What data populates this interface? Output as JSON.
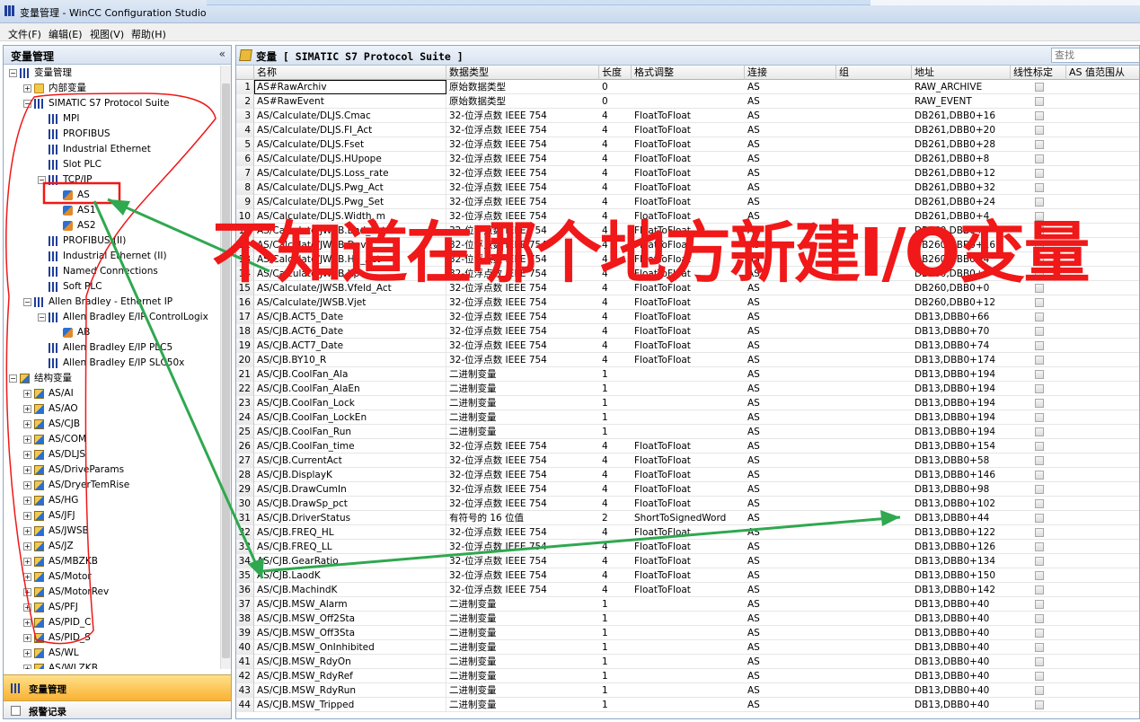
{
  "window": {
    "title": "变量管理 - WinCC Configuration Studio"
  },
  "menu": [
    "文件(F)",
    "编辑(E)",
    "视图(V)",
    "帮助(H)"
  ],
  "left_pane": {
    "title": "变量管理",
    "collapse_glyph": "«",
    "tree": [
      {
        "label": "变量管理",
        "level": 0,
        "icon": "bars",
        "exp": "-"
      },
      {
        "label": "内部变量",
        "level": 1,
        "icon": "folder",
        "exp": "+"
      },
      {
        "label": "SIMATIC S7 Protocol Suite",
        "level": 1,
        "icon": "bars",
        "exp": "-"
      },
      {
        "label": "MPI",
        "level": 2,
        "icon": "bars",
        "exp": ""
      },
      {
        "label": "PROFIBUS",
        "level": 2,
        "icon": "bars",
        "exp": ""
      },
      {
        "label": "Industrial Ethernet",
        "level": 2,
        "icon": "bars",
        "exp": ""
      },
      {
        "label": "Slot PLC",
        "level": 2,
        "icon": "bars",
        "exp": ""
      },
      {
        "label": "TCP/IP",
        "level": 2,
        "icon": "bars",
        "exp": "-"
      },
      {
        "label": "AS",
        "level": 3,
        "icon": "tag",
        "exp": ""
      },
      {
        "label": "AS1",
        "level": 3,
        "icon": "tag",
        "exp": ""
      },
      {
        "label": "AS2",
        "level": 3,
        "icon": "tag",
        "exp": ""
      },
      {
        "label": "PROFIBUS (II)",
        "level": 2,
        "icon": "bars",
        "exp": ""
      },
      {
        "label": "Industrial Ethernet (II)",
        "level": 2,
        "icon": "bars",
        "exp": ""
      },
      {
        "label": "Named Connections",
        "level": 2,
        "icon": "bars",
        "exp": ""
      },
      {
        "label": "Soft PLC",
        "level": 2,
        "icon": "bars",
        "exp": ""
      },
      {
        "label": "Allen Bradley - Ethernet IP",
        "level": 1,
        "icon": "bars",
        "exp": "-"
      },
      {
        "label": "Allen Bradley E/IP ControlLogix",
        "level": 2,
        "icon": "bars",
        "exp": "-"
      },
      {
        "label": "AB",
        "level": 3,
        "icon": "tag",
        "exp": ""
      },
      {
        "label": "Allen Bradley E/IP PLC5",
        "level": 2,
        "icon": "bars",
        "exp": ""
      },
      {
        "label": "Allen Bradley E/IP SLC50x",
        "level": 2,
        "icon": "bars",
        "exp": ""
      },
      {
        "label": "结构变量",
        "level": 0,
        "icon": "struct",
        "exp": "-"
      },
      {
        "label": "AS/AI",
        "level": 1,
        "icon": "struct",
        "exp": "+"
      },
      {
        "label": "AS/AO",
        "level": 1,
        "icon": "struct",
        "exp": "+"
      },
      {
        "label": "AS/CJB",
        "level": 1,
        "icon": "struct",
        "exp": "+"
      },
      {
        "label": "AS/COM",
        "level": 1,
        "icon": "struct",
        "exp": "+"
      },
      {
        "label": "AS/DLJS",
        "level": 1,
        "icon": "struct",
        "exp": "+"
      },
      {
        "label": "AS/DriveParams",
        "level": 1,
        "icon": "struct",
        "exp": "+"
      },
      {
        "label": "AS/DryerTemRise",
        "level": 1,
        "icon": "struct",
        "exp": "+"
      },
      {
        "label": "AS/HG",
        "level": 1,
        "icon": "struct",
        "exp": "+"
      },
      {
        "label": "AS/JFJ",
        "level": 1,
        "icon": "struct",
        "exp": "+"
      },
      {
        "label": "AS/JWSB",
        "level": 1,
        "icon": "struct",
        "exp": "+"
      },
      {
        "label": "AS/JZ",
        "level": 1,
        "icon": "struct",
        "exp": "+"
      },
      {
        "label": "AS/MBZKB",
        "level": 1,
        "icon": "struct",
        "exp": "+"
      },
      {
        "label": "AS/Motor",
        "level": 1,
        "icon": "struct",
        "exp": "+"
      },
      {
        "label": "AS/MotorRev",
        "level": 1,
        "icon": "struct",
        "exp": "+"
      },
      {
        "label": "AS/PFJ",
        "level": 1,
        "icon": "struct",
        "exp": "+"
      },
      {
        "label": "AS/PID_C",
        "level": 1,
        "icon": "struct",
        "exp": "+"
      },
      {
        "label": "AS/PID_S",
        "level": 1,
        "icon": "struct",
        "exp": "+"
      },
      {
        "label": "AS/WL",
        "level": 1,
        "icon": "struct",
        "exp": "+"
      },
      {
        "label": "AS/WLZKB",
        "level": 1,
        "icon": "struct",
        "exp": "+"
      }
    ],
    "nav_items": [
      "变量管理",
      "报警记录"
    ]
  },
  "main_pane": {
    "title": "变量 [ SIMATIC S7 Protocol Suite ]",
    "search_placeholder": "查找",
    "columns": [
      "名称",
      "数据类型",
      "长度",
      "格式调整",
      "连接",
      "组",
      "地址",
      "线性标定",
      "AS 值范围从"
    ],
    "rows": [
      [
        "1",
        "AS#RawArchiv",
        "原始数据类型",
        "0",
        "",
        "AS",
        "",
        "RAW_ARCHIVE"
      ],
      [
        "2",
        "AS#RawEvent",
        "原始数据类型",
        "0",
        "",
        "AS",
        "",
        "RAW_EVENT"
      ],
      [
        "3",
        "AS/Calculate/DLJS.Cmac",
        "32-位浮点数 IEEE 754",
        "4",
        "FloatToFloat",
        "AS",
        "",
        "DB261,DBB0+16"
      ],
      [
        "4",
        "AS/Calculate/DLJS.FI_Act",
        "32-位浮点数 IEEE 754",
        "4",
        "FloatToFloat",
        "AS",
        "",
        "DB261,DBB0+20"
      ],
      [
        "5",
        "AS/Calculate/DLJS.Fset",
        "32-位浮点数 IEEE 754",
        "4",
        "FloatToFloat",
        "AS",
        "",
        "DB261,DBB0+28"
      ],
      [
        "6",
        "AS/Calculate/DLJS.HUpope",
        "32-位浮点数 IEEE 754",
        "4",
        "FloatToFloat",
        "AS",
        "",
        "DB261,DBB0+8"
      ],
      [
        "7",
        "AS/Calculate/DLJS.Loss_rate",
        "32-位浮点数 IEEE 754",
        "4",
        "FloatToFloat",
        "AS",
        "",
        "DB261,DBB0+12"
      ],
      [
        "8",
        "AS/Calculate/DLJS.Pwg_Act",
        "32-位浮点数 IEEE 754",
        "4",
        "FloatToFloat",
        "AS",
        "",
        "DB261,DBB0+32"
      ],
      [
        "9",
        "AS/Calculate/DLJS.Pwg_Set",
        "32-位浮点数 IEEE 754",
        "4",
        "FloatToFloat",
        "AS",
        "",
        "DB261,DBB0+24"
      ],
      [
        "10",
        "AS/Calculate/DLJS.Width_m",
        "32-位浮点数 IEEE 754",
        "4",
        "FloatToFloat",
        "AS",
        "",
        "DB261,DBB0+4"
      ],
      [
        "11",
        "AS/Calculate/JWSB.Bnd_Act",
        "32-位浮点数 IEEE 754",
        "4",
        "FloatToFloat",
        "AS",
        "",
        "DB260,DBB0+0"
      ],
      [
        "12",
        "AS/Calculate/JWSB.Dev",
        "32-位浮点数 IEEE 754",
        "4",
        "FloatToFloat",
        "AS",
        "",
        "DB260,DBB0+16"
      ],
      [
        "13",
        "AS/Calculate/JWSB.Hb_Act",
        "32-位浮点数 IEEE 754",
        "4",
        "FloatToFloat",
        "AS",
        "",
        "DB260,DBB0+4"
      ],
      [
        "14",
        "AS/Calculate/JWSB.Kp",
        "32-位浮点数 IEEE 754",
        "4",
        "FloatToFloat",
        "AS",
        "",
        "DB260,DBB0+8"
      ],
      [
        "15",
        "AS/Calculate/JWSB.Vfeld_Act",
        "32-位浮点数 IEEE 754",
        "4",
        "FloatToFloat",
        "AS",
        "",
        "DB260,DBB0+0"
      ],
      [
        "16",
        "AS/Calculate/JWSB.Vjet",
        "32-位浮点数 IEEE 754",
        "4",
        "FloatToFloat",
        "AS",
        "",
        "DB260,DBB0+12"
      ],
      [
        "17",
        "AS/CJB.ACT5_Date",
        "32-位浮点数 IEEE 754",
        "4",
        "FloatToFloat",
        "AS",
        "",
        "DB13,DBB0+66"
      ],
      [
        "18",
        "AS/CJB.ACT6_Date",
        "32-位浮点数 IEEE 754",
        "4",
        "FloatToFloat",
        "AS",
        "",
        "DB13,DBB0+70"
      ],
      [
        "19",
        "AS/CJB.ACT7_Date",
        "32-位浮点数 IEEE 754",
        "4",
        "FloatToFloat",
        "AS",
        "",
        "DB13,DBB0+74"
      ],
      [
        "20",
        "AS/CJB.BY10_R",
        "32-位浮点数 IEEE 754",
        "4",
        "FloatToFloat",
        "AS",
        "",
        "DB13,DBB0+174"
      ],
      [
        "21",
        "AS/CJB.CoolFan_Ala",
        "二进制变量",
        "1",
        "",
        "AS",
        "",
        "DB13,DBB0+194"
      ],
      [
        "22",
        "AS/CJB.CoolFan_AlaEn",
        "二进制变量",
        "1",
        "",
        "AS",
        "",
        "DB13,DBB0+194"
      ],
      [
        "23",
        "AS/CJB.CoolFan_Lock",
        "二进制变量",
        "1",
        "",
        "AS",
        "",
        "DB13,DBB0+194"
      ],
      [
        "24",
        "AS/CJB.CoolFan_LockEn",
        "二进制变量",
        "1",
        "",
        "AS",
        "",
        "DB13,DBB0+194"
      ],
      [
        "25",
        "AS/CJB.CoolFan_Run",
        "二进制变量",
        "1",
        "",
        "AS",
        "",
        "DB13,DBB0+194"
      ],
      [
        "26",
        "AS/CJB.CoolFan_time",
        "32-位浮点数 IEEE 754",
        "4",
        "FloatToFloat",
        "AS",
        "",
        "DB13,DBB0+154"
      ],
      [
        "27",
        "AS/CJB.CurrentAct",
        "32-位浮点数 IEEE 754",
        "4",
        "FloatToFloat",
        "AS",
        "",
        "DB13,DBB0+58"
      ],
      [
        "28",
        "AS/CJB.DisplayK",
        "32-位浮点数 IEEE 754",
        "4",
        "FloatToFloat",
        "AS",
        "",
        "DB13,DBB0+146"
      ],
      [
        "29",
        "AS/CJB.DrawCumIn",
        "32-位浮点数 IEEE 754",
        "4",
        "FloatToFloat",
        "AS",
        "",
        "DB13,DBB0+98"
      ],
      [
        "30",
        "AS/CJB.DrawSp_pct",
        "32-位浮点数 IEEE 754",
        "4",
        "FloatToFloat",
        "AS",
        "",
        "DB13,DBB0+102"
      ],
      [
        "31",
        "AS/CJB.DriverStatus",
        "有符号的 16 位值",
        "2",
        "ShortToSignedWord",
        "AS",
        "",
        "DB13,DBB0+44"
      ],
      [
        "32",
        "AS/CJB.FREQ_HL",
        "32-位浮点数 IEEE 754",
        "4",
        "FloatToFloat",
        "AS",
        "",
        "DB13,DBB0+122"
      ],
      [
        "33",
        "AS/CJB.FREQ_LL",
        "32-位浮点数 IEEE 754",
        "4",
        "FloatToFloat",
        "AS",
        "",
        "DB13,DBB0+126"
      ],
      [
        "34",
        "AS/CJB.GearRatio",
        "32-位浮点数 IEEE 754",
        "4",
        "FloatToFloat",
        "AS",
        "",
        "DB13,DBB0+134"
      ],
      [
        "35",
        "AS/CJB.LaodK",
        "32-位浮点数 IEEE 754",
        "4",
        "FloatToFloat",
        "AS",
        "",
        "DB13,DBB0+150"
      ],
      [
        "36",
        "AS/CJB.MachindK",
        "32-位浮点数 IEEE 754",
        "4",
        "FloatToFloat",
        "AS",
        "",
        "DB13,DBB0+142"
      ],
      [
        "37",
        "AS/CJB.MSW_Alarm",
        "二进制变量",
        "1",
        "",
        "AS",
        "",
        "DB13,DBB0+40"
      ],
      [
        "38",
        "AS/CJB.MSW_Off2Sta",
        "二进制变量",
        "1",
        "",
        "AS",
        "",
        "DB13,DBB0+40"
      ],
      [
        "39",
        "AS/CJB.MSW_Off3Sta",
        "二进制变量",
        "1",
        "",
        "AS",
        "",
        "DB13,DBB0+40"
      ],
      [
        "40",
        "AS/CJB.MSW_OnInhibited",
        "二进制变量",
        "1",
        "",
        "AS",
        "",
        "DB13,DBB0+40"
      ],
      [
        "41",
        "AS/CJB.MSW_RdyOn",
        "二进制变量",
        "1",
        "",
        "AS",
        "",
        "DB13,DBB0+40"
      ],
      [
        "42",
        "AS/CJB.MSW_RdyRef",
        "二进制变量",
        "1",
        "",
        "AS",
        "",
        "DB13,DBB0+40"
      ],
      [
        "43",
        "AS/CJB.MSW_RdyRun",
        "二进制变量",
        "1",
        "",
        "AS",
        "",
        "DB13,DBB0+40"
      ],
      [
        "44",
        "AS/CJB.MSW_Tripped",
        "二进制变量",
        "1",
        "",
        "AS",
        "",
        "DB13,DBB0+40"
      ]
    ]
  },
  "annotation": {
    "text": "不知道在哪个地方新建I/O变量",
    "color": "#f01818",
    "arrow_color": "#2fa84f"
  }
}
